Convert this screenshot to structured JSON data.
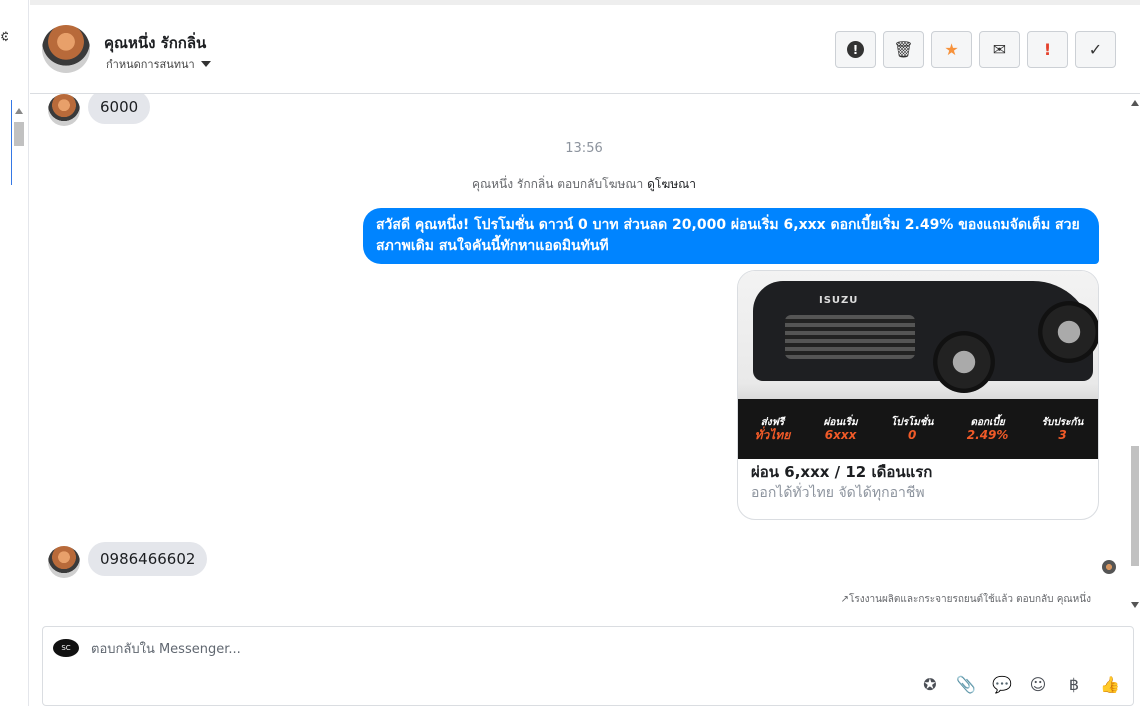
{
  "header": {
    "contact_name": "คุณหนึ่ง รักกลิ่น",
    "conversation_label": "กำหนดการสนทนา",
    "actions": [
      {
        "name": "spam-button",
        "icon": "alert-circle-icon",
        "glyph": "!"
      },
      {
        "name": "delete-button",
        "icon": "trash-icon",
        "glyph": "🗑"
      },
      {
        "name": "star-button",
        "icon": "star-icon",
        "glyph": "★"
      },
      {
        "name": "mark-unread-button",
        "icon": "envelope-icon",
        "glyph": "✉"
      },
      {
        "name": "follow-up-button",
        "icon": "exclamation-icon",
        "glyph": "!"
      },
      {
        "name": "mark-done-button",
        "icon": "check-icon",
        "glyph": "✓"
      }
    ]
  },
  "messages": {
    "first_incoming": "6000",
    "timestamp": "13:56",
    "ad_reply_prefix": "คุณหนึ่ง รักกลิ่น ตอบกลับโฆษณา",
    "ad_reply_link": "ดูโฆษณา",
    "outgoing_text": "สวัสดี คุณหนึ่ง! โปรโมชั่น ดาวน์ 0 บาท ส่วนลด 20,000 ผ่อนเริ่ม 6,xxx ดอกเบี้ยเริ่ม 2.49% ของแถมจัดเต็ม สวยสภาพเดิม สนใจคันนี้ทักหาแอดมินทันที",
    "card": {
      "brand_on_image": "ISUZU",
      "strip": [
        {
          "label": "ส่งฟรี",
          "value": "ทั่วไทย"
        },
        {
          "label": "ผ่อนเริ่ม",
          "value": "6xxx"
        },
        {
          "label": "โปรโมชั่น",
          "value": "0"
        },
        {
          "label": "ดอกเบี้ย",
          "value": "2.49%"
        },
        {
          "label": "รับประกัน",
          "value": "3"
        }
      ],
      "title": "ผ่อน 6,xxx / 12 เดือนแรก",
      "subtitle": "ออกได้ทั่วไทย จัดได้ทุกอาชีพ"
    },
    "second_incoming": "0986466602",
    "footnote": "↗โรงงานผลิตและกระจายรถยนต์ใช้แล้ว ตอบกลับ คุณหนึ่ง"
  },
  "composer": {
    "placeholder": "ตอบกลับใน Messenger...",
    "page_badge": "SC",
    "tools": [
      {
        "name": "saved-reply-button",
        "icon": "chat-star-icon",
        "glyph": "✪"
      },
      {
        "name": "attach-button",
        "icon": "paperclip-icon",
        "glyph": "📎"
      },
      {
        "name": "quick-reply-button",
        "icon": "speech-bubble-icon",
        "glyph": "💬"
      },
      {
        "name": "emoji-button",
        "icon": "smiley-icon",
        "glyph": "☺"
      },
      {
        "name": "payment-button",
        "icon": "baht-icon",
        "glyph": "฿"
      },
      {
        "name": "like-button",
        "icon": "thumbs-up-icon",
        "glyph": "👍"
      }
    ]
  },
  "colors": {
    "outgoing_bubble": "#0084ff",
    "incoming_bubble": "#e4e6eb",
    "star": "#f7923b",
    "flag": "#e4412c"
  }
}
